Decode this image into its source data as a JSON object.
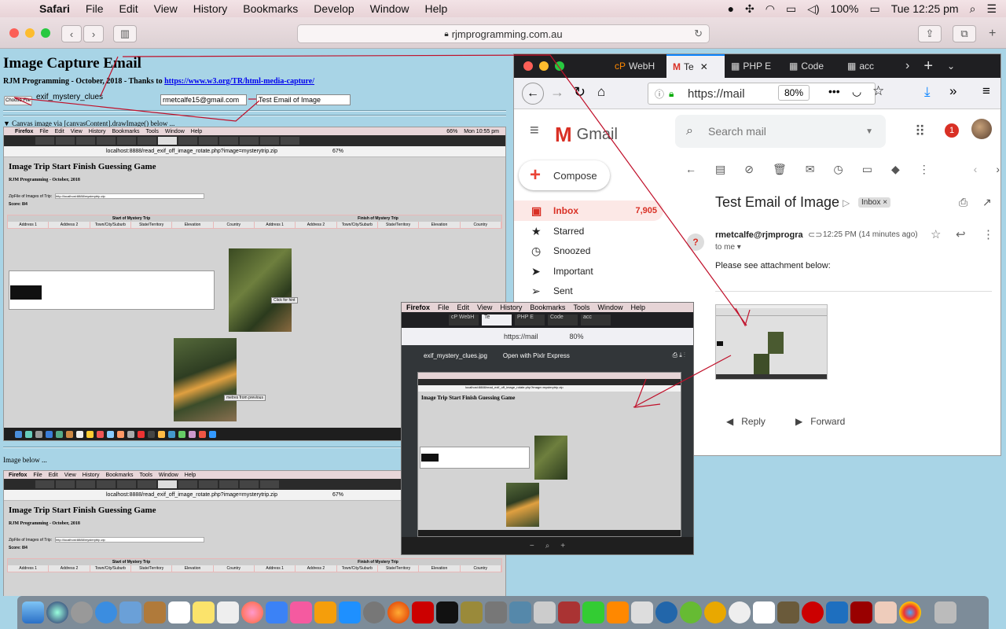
{
  "menubar": {
    "app": "Safari",
    "items": [
      "File",
      "Edit",
      "View",
      "History",
      "Bookmarks",
      "Develop",
      "Window",
      "Help"
    ],
    "battery": "100%",
    "clock": "Tue 12:25 pm"
  },
  "safari": {
    "url": "rjmprogramming.com.au"
  },
  "page": {
    "title": "Image Capture Email",
    "credit": "RJM Programming - October, 2018 - Thanks to",
    "link": "https://www.w3.org/TR/html-media-capture/",
    "choose_file": "Choose File",
    "file_name": "exif_mystery_clues",
    "email_value": "rmetcalfe15@gmail.com",
    "subject_value": "Test Email of Image",
    "canvas_caption": "▼ Canvas image via [canvasContent].drawImage() below ...",
    "image_caption": "Image below ..."
  },
  "inner_shot": {
    "app": "Firefox",
    "menu": [
      "File",
      "Edit",
      "View",
      "History",
      "Bookmarks",
      "Tools",
      "Window",
      "Help"
    ],
    "clock": "Mon 10:55 pm",
    "battery": "66%",
    "url": "localhost:8888/read_exif_off_image_rotate.php?image=mysterytrip.zip",
    "zoom": "67%",
    "title": "Image Trip Start Finish Guessing Game",
    "subtitle": "RJM Programming - October, 2018",
    "zip_label": "ZipFile of Images of Trip:",
    "zip_value": "http://localhost:8888/mysterytrip.zip",
    "score": "Score: 8/4",
    "start_header": "Start of Mystery Trip",
    "finish_header": "Finish of Mystery Trip",
    "columns": [
      "Address 1",
      "Address 2",
      "Town/City/Suburb",
      "State/Territory",
      "Elevation",
      "Country"
    ],
    "hint_button": "Click for hint",
    "metres_button": "metres from previous"
  },
  "firefox": {
    "tabs": [
      "WebH",
      "Te",
      "PHP E",
      "Code",
      "acc"
    ],
    "url": "https://mail",
    "zoom": "80%"
  },
  "gmail": {
    "logo": "Gmail",
    "search_placeholder": "Search mail",
    "badge": "1",
    "compose": "Compose",
    "nav": [
      {
        "label": "Inbox",
        "count": "7,905"
      },
      {
        "label": "Starred"
      },
      {
        "label": "Snoozed"
      },
      {
        "label": "Important"
      },
      {
        "label": "Sent"
      }
    ],
    "subject": "Test Email of Image",
    "chip": "Inbox",
    "sender": "rmetcalfe@rjmprogra",
    "time": "12:25 PM (14 minutes ago)",
    "to": "to me",
    "body": "Please see attachment below:",
    "reply": "Reply",
    "forward": "Forward"
  },
  "pdf_window": {
    "app": "Firefox",
    "menu": [
      "File",
      "Edit",
      "View",
      "History",
      "Bookmarks",
      "Tools",
      "Window",
      "Help"
    ],
    "tabs": [
      "cP WebH",
      "Te",
      "PHP E",
      "Code",
      "acc"
    ],
    "url": "https://mail",
    "zoom": "80%",
    "file": "exif_mystery_clues.jpg",
    "open_with": "Open with Pixlr Express"
  }
}
